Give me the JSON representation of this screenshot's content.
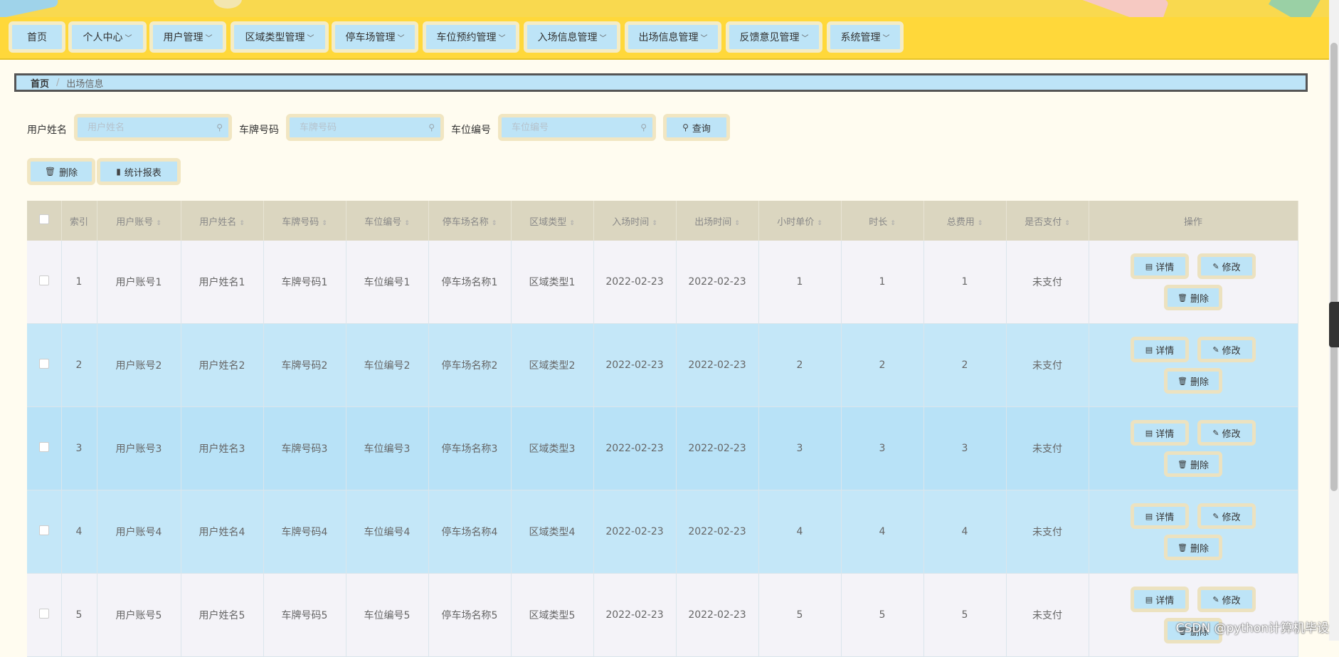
{
  "nav": {
    "items": [
      {
        "label": "首页"
      },
      {
        "label": "个人中心"
      },
      {
        "label": "用户管理"
      },
      {
        "label": "区域类型管理"
      },
      {
        "label": "停车场管理"
      },
      {
        "label": "车位预约管理"
      },
      {
        "label": "入场信息管理"
      },
      {
        "label": "出场信息管理"
      },
      {
        "label": "反馈意见管理"
      },
      {
        "label": "系统管理"
      }
    ]
  },
  "breadcrumb": {
    "home": "首页",
    "separator": "/",
    "current": "出场信息"
  },
  "search": {
    "user_name_label": "用户姓名",
    "user_name_placeholder": "用户姓名",
    "plate_label": "车牌号码",
    "plate_placeholder": "车牌号码",
    "space_label": "车位编号",
    "space_placeholder": "车位编号",
    "query_button": "查询"
  },
  "actions": {
    "delete_button": "删除",
    "report_button": "统计报表"
  },
  "table": {
    "headers": [
      "索引",
      "用户账号",
      "用户姓名",
      "车牌号码",
      "车位编号",
      "停车场名称",
      "区域类型",
      "入场时间",
      "出场时间",
      "小时单价",
      "时长",
      "总费用",
      "是否支付",
      "操作"
    ],
    "rows": [
      {
        "index": "1",
        "account": "用户账号1",
        "name": "用户姓名1",
        "plate": "车牌号码1",
        "space": "车位编号1",
        "lot": "停车场名称1",
        "area": "区域类型1",
        "in_time": "2022-02-23",
        "out_time": "2022-02-23",
        "price": "1",
        "duration": "1",
        "total": "1",
        "paid": "未支付"
      },
      {
        "index": "2",
        "account": "用户账号2",
        "name": "用户姓名2",
        "plate": "车牌号码2",
        "space": "车位编号2",
        "lot": "停车场名称2",
        "area": "区域类型2",
        "in_time": "2022-02-23",
        "out_time": "2022-02-23",
        "price": "2",
        "duration": "2",
        "total": "2",
        "paid": "未支付"
      },
      {
        "index": "3",
        "account": "用户账号3",
        "name": "用户姓名3",
        "plate": "车牌号码3",
        "space": "车位编号3",
        "lot": "停车场名称3",
        "area": "区域类型3",
        "in_time": "2022-02-23",
        "out_time": "2022-02-23",
        "price": "3",
        "duration": "3",
        "total": "3",
        "paid": "未支付"
      },
      {
        "index": "4",
        "account": "用户账号4",
        "name": "用户姓名4",
        "plate": "车牌号码4",
        "space": "车位编号4",
        "lot": "停车场名称4",
        "area": "区域类型4",
        "in_time": "2022-02-23",
        "out_time": "2022-02-23",
        "price": "4",
        "duration": "4",
        "total": "4",
        "paid": "未支付"
      },
      {
        "index": "5",
        "account": "用户账号5",
        "name": "用户姓名5",
        "plate": "车牌号码5",
        "space": "车位编号5",
        "lot": "停车场名称5",
        "area": "区域类型5",
        "in_time": "2022-02-23",
        "out_time": "2022-02-23",
        "price": "5",
        "duration": "5",
        "total": "5",
        "paid": "未支付"
      }
    ],
    "row_actions": {
      "detail": "详情",
      "edit": "修改",
      "delete": "删除"
    }
  },
  "watermark": "CSDN @python计算机毕设",
  "colors": {
    "nav_bg": "#ffd83a",
    "button_bg": "#bde4f7",
    "button_border": "#f1e6c2",
    "header_bg": "#dbd6c0",
    "page_bg": "#fffcf0"
  }
}
